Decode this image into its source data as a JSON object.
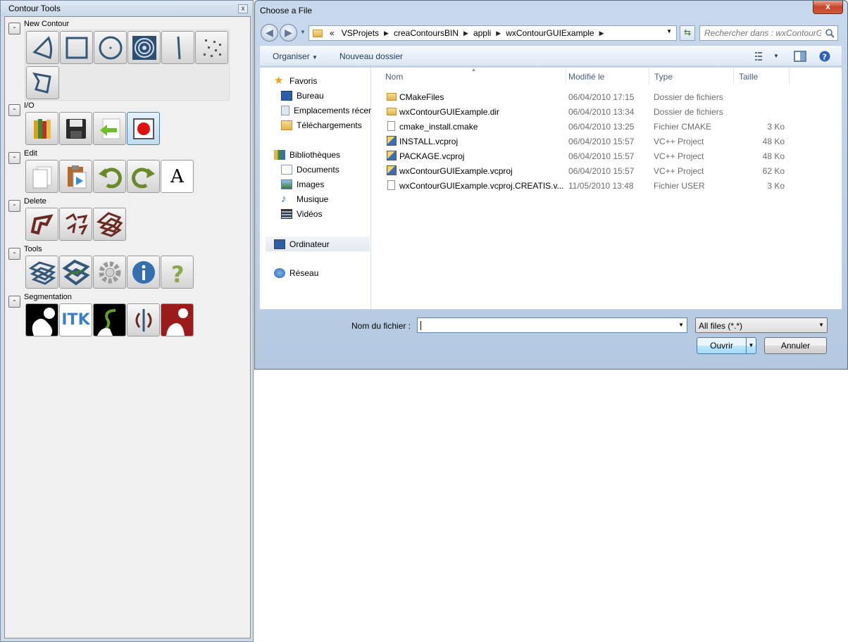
{
  "palette": {
    "title": "Contour Tools",
    "close_glyph": "x",
    "collapse_glyph": "-",
    "sections": {
      "new_contour": {
        "label": "New Contour",
        "tools": [
          "spline-contour-icon",
          "rectangle-contour-icon",
          "circle-contour-icon",
          "bullseye-contour-icon",
          "line-contour-icon",
          "points-contour-icon",
          "polygon-contour-icon"
        ]
      },
      "io": {
        "label": "I/O",
        "tools": [
          "open-folder-icon",
          "save-floppy-icon",
          "import-arrow-icon",
          "record-icon"
        ]
      },
      "edit": {
        "label": "Edit",
        "tools": [
          "copy-pages-icon",
          "paste-clipboard-icon",
          "undo-arrow-icon",
          "redo-arrow-icon",
          "text-label-icon"
        ]
      },
      "delete": {
        "label": "Delete",
        "tools": [
          "delete-contour-icon",
          "delete-contours-icon",
          "delete-all-contours-icon"
        ]
      },
      "tools": {
        "label": "Tools",
        "tools": [
          "contour-stack-icon",
          "contour-merge-icon",
          "gear-icon",
          "info-icon",
          "help-icon"
        ]
      },
      "segmentation": {
        "label": "Segmentation",
        "tools": [
          "segmentation-mask-icon",
          "itk-icon",
          "snake-segmentation-icon",
          "split-contour-icon",
          "region-segmentation-icon"
        ],
        "itk_text": "ITK",
        "text_tool_glyph": "A"
      }
    }
  },
  "dialog": {
    "title": "Choose a File",
    "close_glyph": "x",
    "breadcrumb": {
      "prefix": "«",
      "items": [
        "VSProjets",
        "creaContoursBIN",
        "appli",
        "wxContourGUIExample"
      ]
    },
    "search": {
      "placeholder": "Rechercher dans : wxContourG..."
    },
    "toolbar": {
      "organize": "Organiser",
      "new_folder": "Nouveau dossier"
    },
    "nav": {
      "favorites": "Favoris",
      "desktop": "Bureau",
      "recent": "Emplacements récer",
      "downloads": "Téléchargements",
      "libraries": "Bibliothèques",
      "documents": "Documents",
      "images": "Images",
      "music": "Musique",
      "videos": "Vidéos",
      "computer": "Ordinateur",
      "network": "Réseau"
    },
    "columns": {
      "name": "Nom",
      "modified": "Modifié le",
      "type": "Type",
      "size": "Taille"
    },
    "files": [
      {
        "name": "CMakeFiles",
        "modified": "06/04/2010 17:15",
        "type": "Dossier de fichiers",
        "size": "",
        "icon": "folder-icon"
      },
      {
        "name": "wxContourGUIExample.dir",
        "modified": "06/04/2010 13:34",
        "type": "Dossier de fichiers",
        "size": "",
        "icon": "folder-icon"
      },
      {
        "name": "cmake_install.cmake",
        "modified": "06/04/2010 13:25",
        "type": "Fichier CMAKE",
        "size": "3 Ko",
        "icon": "file-icon"
      },
      {
        "name": "INSTALL.vcproj",
        "modified": "06/04/2010 15:57",
        "type": "VC++ Project",
        "size": "48 Ko",
        "icon": "vcproj-icon"
      },
      {
        "name": "PACKAGE.vcproj",
        "modified": "06/04/2010 15:57",
        "type": "VC++ Project",
        "size": "48 Ko",
        "icon": "vcproj-icon"
      },
      {
        "name": "wxContourGUIExample.vcproj",
        "modified": "06/04/2010 15:57",
        "type": "VC++ Project",
        "size": "62 Ko",
        "icon": "vcproj-icon"
      },
      {
        "name": "wxContourGUIExample.vcproj.CREATIS.v...",
        "modified": "11/05/2010 13:48",
        "type": "Fichier USER",
        "size": "3 Ko",
        "icon": "file-icon"
      }
    ],
    "filename_label": "Nom du fichier :",
    "filename_value": "",
    "filter": "All files (*.*)",
    "open_button": "Ouvrir",
    "cancel_button": "Annuler"
  }
}
